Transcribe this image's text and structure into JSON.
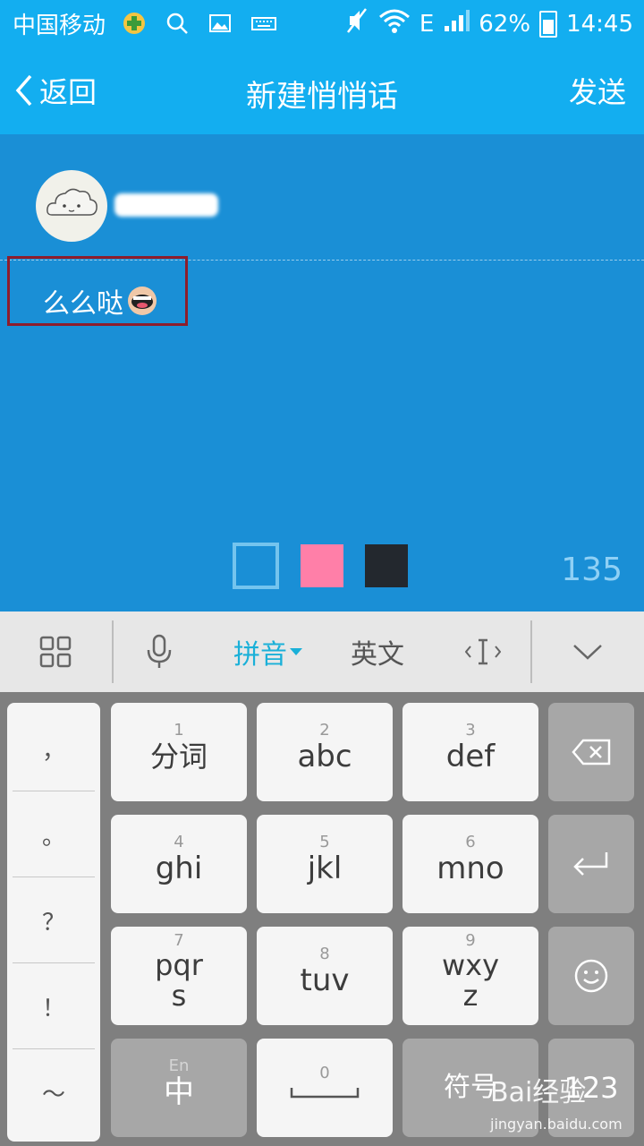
{
  "status": {
    "carrier": "中国移动",
    "network": "E",
    "battery": "62%",
    "time": "14:45"
  },
  "header": {
    "back_label": "返回",
    "title": "新建悄悄话",
    "send_label": "发送"
  },
  "message": {
    "text": "么么哒"
  },
  "colors": {
    "accent": "#13aef0",
    "content_bg": "#1a8fd6",
    "swatches": [
      "#1a8fd6",
      "#ff7fa8",
      "#23282e"
    ]
  },
  "counter": "135",
  "keyboard": {
    "bar": {
      "pinyin": "拼音",
      "english": "英文"
    },
    "punct": [
      "，",
      "。",
      "？",
      "！",
      "～"
    ],
    "keys": [
      {
        "num": "1",
        "label": "分词"
      },
      {
        "num": "2",
        "label": "abc"
      },
      {
        "num": "3",
        "label": "def"
      },
      {
        "num": "4",
        "label": "ghi"
      },
      {
        "num": "5",
        "label": "jkl"
      },
      {
        "num": "6",
        "label": "mno"
      },
      {
        "num": "7",
        "label": "pqrs"
      },
      {
        "num": "8",
        "label": "tuv"
      },
      {
        "num": "9",
        "label": "wxyz"
      }
    ],
    "lang_small": "En",
    "lang_main": "中",
    "space_num": "0",
    "symbols": "符号",
    "numbers": "123"
  },
  "watermark": {
    "logo": "Bai经验",
    "url": "jingyan.baidu.com"
  }
}
